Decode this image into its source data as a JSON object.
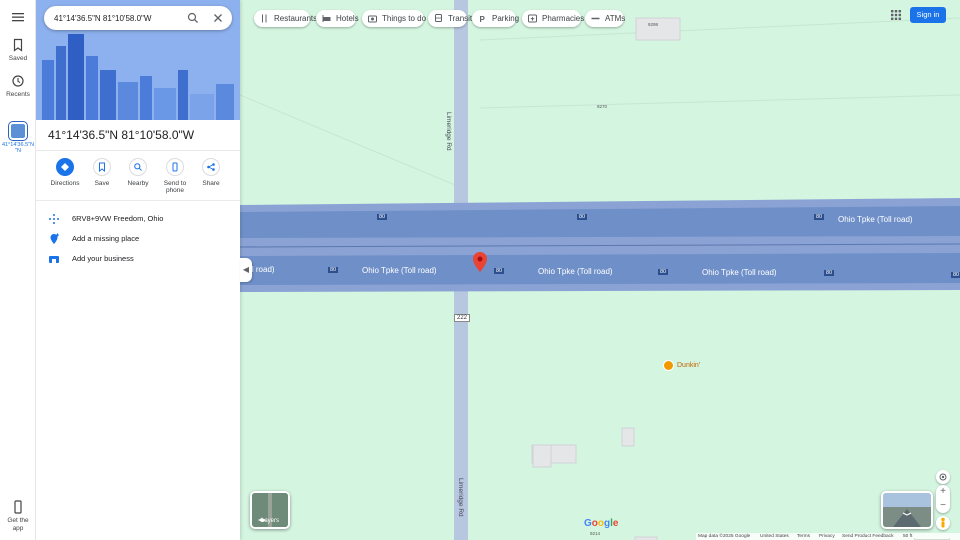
{
  "rail": {
    "saved_label": "Saved",
    "recents_label": "Recents",
    "recent_place_label": "41°14'36.5\"N",
    "recent_place_label2": "\"N",
    "get_app_label": "Get the app"
  },
  "search": {
    "value": "41°14'36.5\"N 81°10'58.0\"W"
  },
  "place": {
    "title": "41°14'36.5\"N 81°10'58.0\"W"
  },
  "actions": [
    {
      "label": "Directions",
      "icon": "directions-icon"
    },
    {
      "label": "Save",
      "icon": "bookmark-icon"
    },
    {
      "label": "Nearby",
      "icon": "nearby-icon"
    },
    {
      "label": "Send to phone",
      "label_line1": "Send to",
      "label_line2": "phone",
      "icon": "phone-icon"
    },
    {
      "label": "Share",
      "icon": "share-icon"
    }
  ],
  "info": {
    "plus_code": "6RV8+9VW Freedom, Ohio",
    "add_missing_place": "Add a missing place",
    "add_business": "Add your business"
  },
  "chips": [
    {
      "label": "Restaurants",
      "icon": "restaurant-icon"
    },
    {
      "label": "Hotels",
      "icon": "hotel-icon"
    },
    {
      "label": "Things to do",
      "icon": "camera-icon"
    },
    {
      "label": "Transit",
      "icon": "train-icon"
    },
    {
      "label": "Parking",
      "icon": "parking-icon"
    },
    {
      "label": "Pharmacies",
      "icon": "pharmacy-icon"
    },
    {
      "label": "ATMs",
      "icon": "atm-icon"
    }
  ],
  "header": {
    "sign_in_label": "Sign in"
  },
  "map": {
    "road_vertical": "Limeridge Rd",
    "highway_label": "Ohio Tpke (Toll road)",
    "highway_shield": "80",
    "route_222": "222",
    "shield_9298": "9298",
    "shield_9270": "9270",
    "shield_9214": "9214",
    "poi_dunkin": "Dunkin'",
    "layers_label": "Layers",
    "logo_text": "Google"
  },
  "footer": {
    "map_data": "Map data ©2025 Google",
    "country": "United States",
    "terms": "Terms",
    "privacy": "Privacy",
    "feedback": "Send Product Feedback",
    "scale": "50 ft"
  },
  "colors": {
    "map_bg": "#d4f5e0",
    "highway": "#6f8fc8",
    "highway_edge": "#4f6da9",
    "road": "#b8c7e0",
    "accent": "#1a73e8",
    "pin": "#ea4335"
  }
}
